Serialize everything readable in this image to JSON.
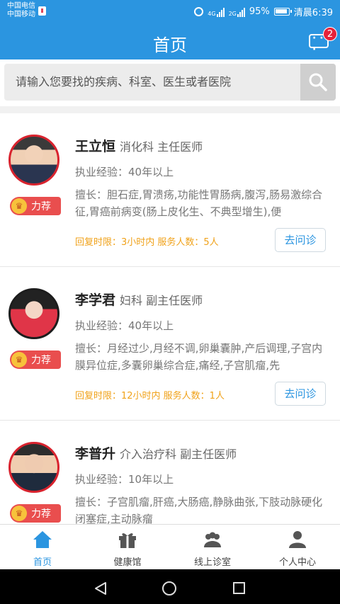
{
  "status_bar": {
    "carrier1": "中国电信",
    "carrier2": "中国移动",
    "net1": "4G",
    "net2": "2G",
    "battery": "95%",
    "time": "清晨6:39"
  },
  "header": {
    "title": "首页",
    "message_badge": "2"
  },
  "search": {
    "placeholder": "请输入您要找的疾病、科室、医生或者医院"
  },
  "doctors": [
    {
      "name": "王立恒",
      "dept": "消化科 主任医师",
      "experience": "执业经验：40年以上",
      "skills": "擅长：胆石症,胃溃疡,功能性胃肠病,腹泻,肠易激综合征,胃癌前病变(肠上皮化生、不典型增生),便",
      "badge": "力荐",
      "meta": "回复时限：3小时内 服务人数：5人",
      "consult": "去问诊"
    },
    {
      "name": "李学君",
      "dept": "妇科 副主任医师",
      "experience": "执业经验：40年以上",
      "skills": "擅长：月经过少,月经不调,卵巢囊肿,产后调理,子宫内膜异位症,多囊卵巢综合症,痛经,子宫肌瘤,先",
      "badge": "力荐",
      "meta": "回复时限：12小时内 服务人数：1人",
      "consult": "去问诊"
    },
    {
      "name": "李普升",
      "dept": "介入治疗科 副主任医师",
      "experience": "执业经验：10年以上",
      "skills": "擅长：子宫肌瘤,肝癌,大肠癌,静脉曲张,下肢动脉硬化闭塞症,主动脉瘤",
      "badge": "力荐"
    }
  ],
  "tabs": [
    {
      "label": "首页",
      "icon": "home-icon",
      "active": true
    },
    {
      "label": "健康馆",
      "icon": "gift-icon",
      "active": false
    },
    {
      "label": "线上诊室",
      "icon": "people-icon",
      "active": false
    },
    {
      "label": "个人中心",
      "icon": "person-icon",
      "active": false
    }
  ],
  "colors": {
    "primary": "#2b95e0",
    "badge_red": "#e6223a",
    "recommend": "#e94e4e",
    "meta_orange": "#f0a21a"
  }
}
